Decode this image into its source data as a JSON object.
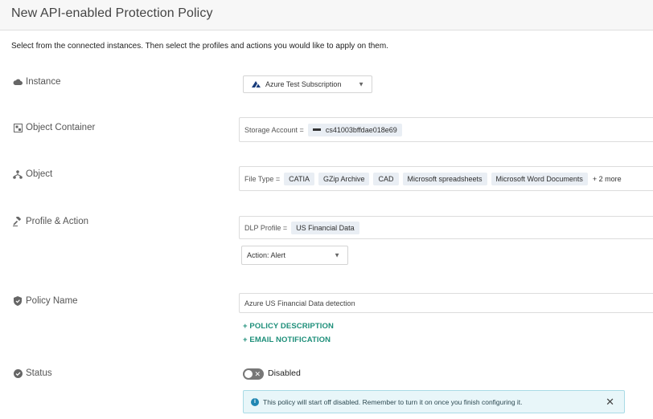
{
  "header": {
    "title": "New API-enabled Protection Policy"
  },
  "intro": "Select from the connected instances. Then select the profiles and actions you would like to apply on them.",
  "rows": {
    "instance": {
      "label": "Instance",
      "icon": "cloud-icon",
      "value": "Azure Test Subscription"
    },
    "object_container": {
      "label": "Object Container",
      "icon": "container-icon",
      "prefix": "Storage Account =",
      "value": "cs41003bffdae018e69"
    },
    "object": {
      "label": "Object",
      "icon": "hierarchy-icon",
      "prefix": "File Type =",
      "chips": [
        "CATIA",
        "GZip Archive",
        "CAD",
        "Microsoft spreadsheets",
        "Microsoft Word Documents"
      ],
      "more": "+ 2 more"
    },
    "profile_action": {
      "label": "Profile & Action",
      "icon": "gavel-icon",
      "prefix": "DLP Profile =",
      "profile": "US Financial Data",
      "action": "Action: Alert"
    },
    "policy_name": {
      "label": "Policy Name",
      "icon": "shield-icon",
      "value": "Azure US Financial Data detection"
    },
    "status": {
      "label": "Status",
      "icon": "check-circle-icon",
      "toggle_label": "Disabled"
    }
  },
  "links": {
    "policy_description": "+ POLICY DESCRIPTION",
    "email_notification": "+ EMAIL NOTIFICATION"
  },
  "banner": {
    "message": "This policy will start off disabled. Remember to turn it on once you finish configuring it."
  },
  "colors": {
    "link": "#1e8f7a",
    "azure": "#1a3d7c",
    "banner_bg": "#e8f6f9",
    "banner_border": "#a9dbe6",
    "toggle_off": "#777777"
  }
}
